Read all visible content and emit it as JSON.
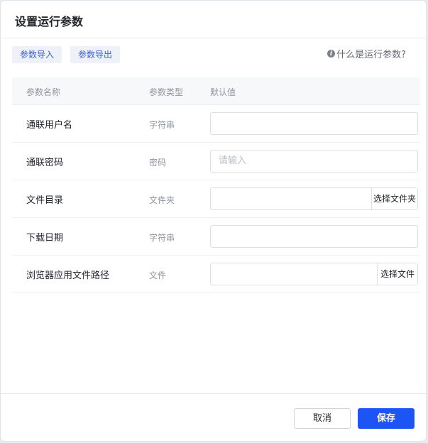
{
  "dialog": {
    "title": "设置运行参数"
  },
  "toolbar": {
    "import_label": "参数导入",
    "export_label": "参数导出",
    "help_label": "什么是运行参数?",
    "help_icon": "info-icon"
  },
  "table": {
    "headers": [
      "参数名称",
      "参数类型",
      "默认值"
    ],
    "rows": [
      {
        "name": "通联用户名",
        "type": "字符串",
        "value": "",
        "placeholder": ""
      },
      {
        "name": "通联密码",
        "type": "密码",
        "value": "",
        "placeholder": "请输入"
      },
      {
        "name": "文件目录",
        "type": "文件夹",
        "value": "",
        "button": "选择文件夹"
      },
      {
        "name": "下载日期",
        "type": "字符串",
        "value": ""
      },
      {
        "name": "浏览器应用文件路径",
        "type": "文件",
        "value": "",
        "button": "选择文件"
      }
    ]
  },
  "footer": {
    "cancel_label": "取消",
    "save_label": "保存"
  },
  "colors": {
    "primary": "#1d55f5",
    "link": "#3a62c8"
  }
}
